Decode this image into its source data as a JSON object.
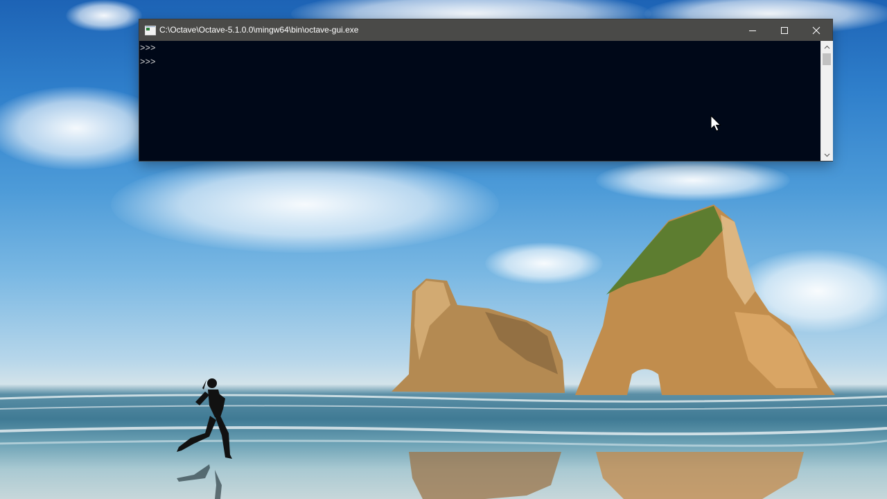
{
  "window": {
    "title": "C:\\Octave\\Octave-5.1.0.0\\mingw64\\bin\\octave-gui.exe",
    "icon": "console-app-icon",
    "controls": {
      "minimize": "minimize-icon",
      "maximize": "maximize-icon",
      "close": "close-icon"
    }
  },
  "console": {
    "lines": [
      ">>>",
      ">>>"
    ],
    "background": "#000818",
    "text_color": "#d8d8d8"
  },
  "scrollbar": {
    "up": "chevron-up-icon",
    "down": "chevron-down-icon"
  },
  "desktop": {
    "wallpaper": "beach-with-rock-arches-and-runner"
  },
  "colors": {
    "titlebar": "#4a4a48",
    "titlebar_text": "#ffffff"
  }
}
